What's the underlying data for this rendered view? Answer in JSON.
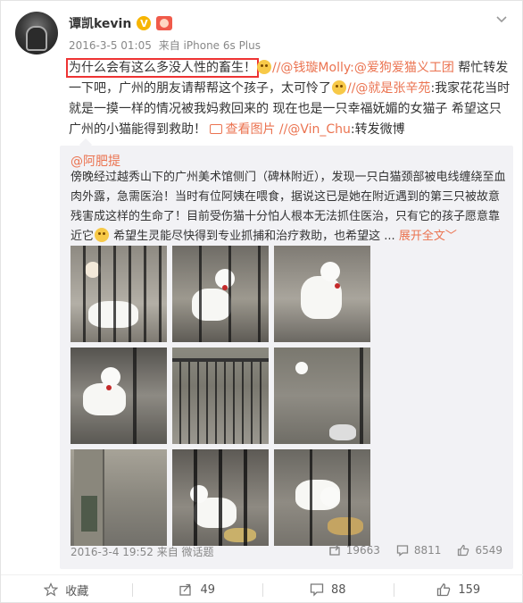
{
  "post": {
    "username": "谭凯kevin",
    "verified_badge": "V",
    "timestamp": "2016-3-5 01:05",
    "via": "来自",
    "source": "iPhone 6s Plus",
    "highlight": "为什么会有这么多没人性的畜生！",
    "seg1": "//@钱璇Molly:@爱狗爱猫义工团",
    "seg2": " 帮忙转发一下吧，广州的朋友请帮帮这个孩子，太可怜了",
    "seg3": "//@就是张辛苑",
    "seg4": ":我家花花当时就是一摸一样的情况被我妈救回来的 现在也是一只幸福妩媚的女猫子 希望这只广州的小猫能得到救助！ ",
    "view_pics": "查看图片",
    "seg5": " //@Vin_Chu",
    "seg6": ":转发微博"
  },
  "repost": {
    "author": "@阿肥提",
    "text": "傍晚经过越秀山下的广州美术馆侧门（碑林附近），发现一只白猫颈部被电线缠绕至血肉外露，急需医治！当时有位阿姨在喂食，据说这已是她在附近遇到的第三只被故意残害成这样的生命了！目前受伤猫十分怕人根本无法抓住医治，只有它的孩子愿意靠近它",
    "text_tail": " 希望生灵能尽快得到专业抓捕和治疗救助，也希望这 ...",
    "expand": "展开全文",
    "expand_arrow": "﹀",
    "timestamp": "2016-3-4 19:52",
    "via": "来自",
    "source": "微话题",
    "repost_count": "19663",
    "comment_count": "8811",
    "like_count": "6549"
  },
  "actions": {
    "favorite": "收藏",
    "repost": "49",
    "comment": "88",
    "like": "159"
  },
  "colors": {
    "link": "#eb7350",
    "highlight_box": "#ee3333",
    "repost_bg": "#f2f2f5"
  }
}
